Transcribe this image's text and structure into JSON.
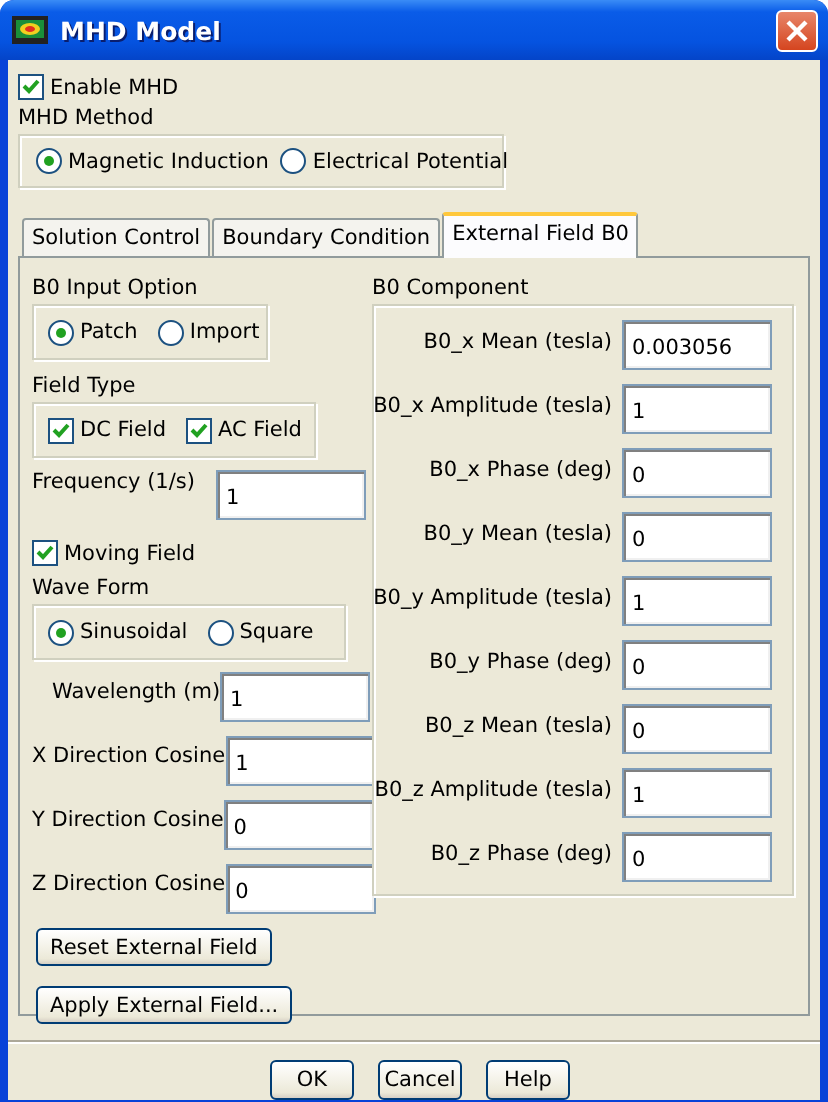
{
  "window": {
    "title": "MHD Model"
  },
  "enable_mhd": {
    "label": "Enable MHD",
    "checked": true
  },
  "mhd_method": {
    "label": "MHD Method",
    "options": [
      {
        "label": "Magnetic Induction",
        "selected": true
      },
      {
        "label": "Electrical Potential",
        "selected": false
      }
    ]
  },
  "tabs": [
    {
      "label": "Solution Control",
      "selected": false
    },
    {
      "label": "Boundary Condition",
      "selected": false
    },
    {
      "label": "External Field B0",
      "selected": true
    }
  ],
  "b0_input_option": {
    "label": "B0 Input Option",
    "options": [
      {
        "label": "Patch",
        "selected": true
      },
      {
        "label": "Import",
        "selected": false
      }
    ]
  },
  "field_type": {
    "label": "Field Type",
    "options": [
      {
        "label": "DC Field",
        "checked": true
      },
      {
        "label": "AC Field",
        "checked": true
      }
    ]
  },
  "frequency": {
    "label": "Frequency (1/s)",
    "value": "1"
  },
  "moving_field": {
    "label": "Moving Field",
    "checked": true
  },
  "wave_form": {
    "label": "Wave Form",
    "options": [
      {
        "label": "Sinusoidal",
        "selected": true
      },
      {
        "label": "Square",
        "selected": false
      }
    ]
  },
  "wave_fields": [
    {
      "label": "Wavelength (m)",
      "value": "1"
    },
    {
      "label": "X Direction Cosine",
      "value": "1"
    },
    {
      "label": "Y Direction Cosine",
      "value": "0"
    },
    {
      "label": "Z Direction Cosine",
      "value": "0"
    }
  ],
  "b0_component": {
    "label": "B0 Component",
    "fields": [
      {
        "label": "B0_x Mean (tesla)",
        "value": "0.003056"
      },
      {
        "label": "B0_x Amplitude (tesla)",
        "value": "1"
      },
      {
        "label": "B0_x Phase (deg)",
        "value": "0"
      },
      {
        "label": "B0_y Mean (tesla)",
        "value": "0"
      },
      {
        "label": "B0_y Amplitude (tesla)",
        "value": "1"
      },
      {
        "label": "B0_y Phase (deg)",
        "value": "0"
      },
      {
        "label": "B0_z Mean (tesla)",
        "value": "0"
      },
      {
        "label": "B0_z Amplitude (tesla)",
        "value": "1"
      },
      {
        "label": "B0_z Phase (deg)",
        "value": "0"
      }
    ]
  },
  "panel_buttons": [
    "Reset External Field",
    "Apply External Field..."
  ],
  "buttons": [
    "OK",
    "Cancel",
    "Help"
  ]
}
